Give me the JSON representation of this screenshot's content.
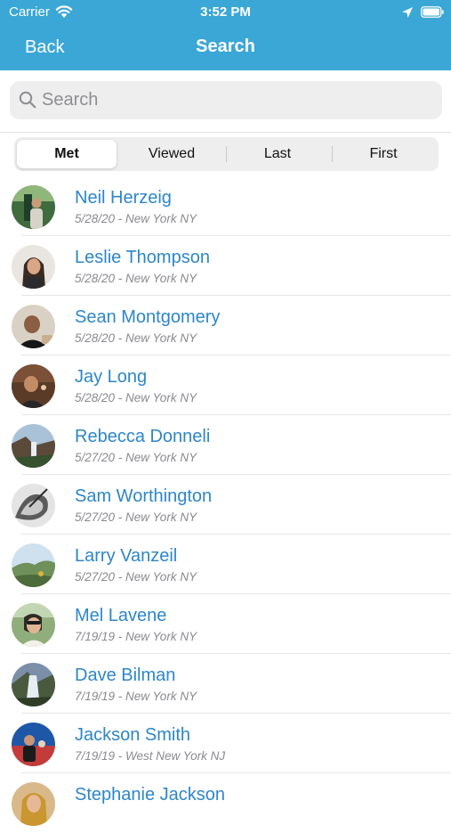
{
  "status_bar": {
    "carrier": "Carrier",
    "time": "3:52 PM"
  },
  "nav": {
    "back_label": "Back",
    "title": "Search"
  },
  "search": {
    "placeholder": "Search",
    "value": ""
  },
  "segments": [
    {
      "label": "Met",
      "selected": true
    },
    {
      "label": "Viewed",
      "selected": false
    },
    {
      "label": "Last",
      "selected": false
    },
    {
      "label": "First",
      "selected": false
    }
  ],
  "contacts": [
    {
      "name": "Neil Herzeig",
      "subtitle": "5/28/20 - New York NY"
    },
    {
      "name": "Leslie Thompson",
      "subtitle": "5/28/20 - New York NY"
    },
    {
      "name": "Sean Montgomery",
      "subtitle": "5/28/20 - New York NY"
    },
    {
      "name": "Jay Long",
      "subtitle": "5/28/20 - New York NY"
    },
    {
      "name": "Rebecca Donneli",
      "subtitle": "5/27/20 - New York NY"
    },
    {
      "name": "Sam Worthington",
      "subtitle": "5/27/20 - New York NY"
    },
    {
      "name": "Larry Vanzeil",
      "subtitle": "5/27/20 - New York NY"
    },
    {
      "name": "Mel Lavene",
      "subtitle": "7/19/19 - New York NY"
    },
    {
      "name": "Dave Bilman",
      "subtitle": "7/19/19 - New York NY"
    },
    {
      "name": "Jackson Smith",
      "subtitle": "7/19/19 - West New York NJ"
    },
    {
      "name": "Stephanie Jackson",
      "subtitle": ""
    }
  ],
  "colors": {
    "nav_bar": "#3aa7d6",
    "name_text": "#2d86c9",
    "subtitle_text": "#8a8a8f"
  }
}
